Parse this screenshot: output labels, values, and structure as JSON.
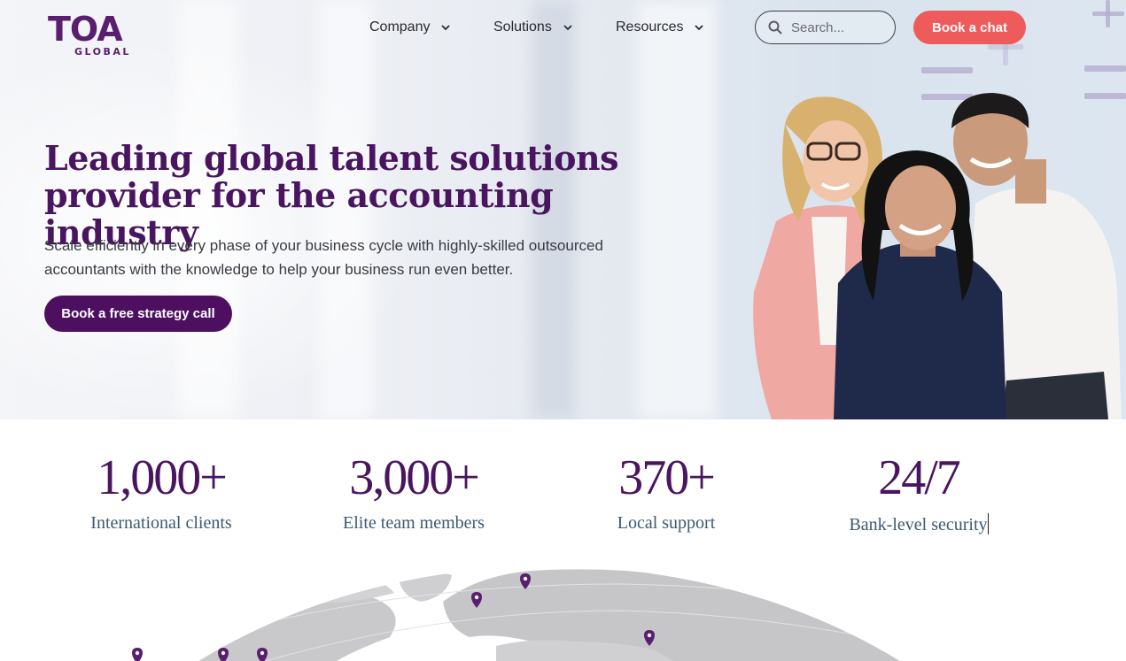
{
  "brand": {
    "logo_text": "TOA",
    "logo_sub": "GLOBAL"
  },
  "nav": {
    "items": [
      {
        "label": "Company"
      },
      {
        "label": "Solutions"
      },
      {
        "label": "Resources"
      }
    ]
  },
  "search": {
    "placeholder": "Search..."
  },
  "header": {
    "cta_label": "Book a chat"
  },
  "hero": {
    "headline_line1": "Leading global talent solutions",
    "headline_line2": "provider for the accounting industry",
    "subtext": "Scale efficiently in every phase of your business cycle with highly-skilled outsourced accountants with the knowledge to help your business run even better.",
    "cta_label": "Book a free strategy call"
  },
  "stats": [
    {
      "value": "1,000+",
      "label": "International clients"
    },
    {
      "value": "3,000+",
      "label": "Elite team members"
    },
    {
      "value": "370+",
      "label": "Local support"
    },
    {
      "value": "24/7",
      "label": "Bank-level security"
    }
  ],
  "colors": {
    "brand_purple": "#4d1061",
    "accent_coral": "#ef5a5a",
    "stat_label": "#3a5a73"
  },
  "icons": {
    "search": "search-icon",
    "chevron": "chevron-down-icon",
    "map_pin": "map-pin-icon"
  }
}
